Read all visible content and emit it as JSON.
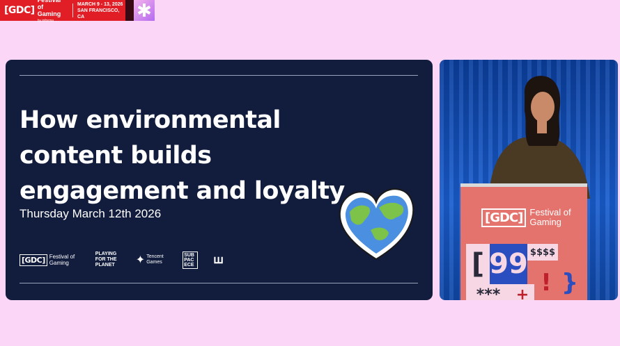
{
  "banner": {
    "logo": "[GDC]",
    "name": "Festival\nof Gaming",
    "by": "by informa",
    "dates": "MARCH 9 - 13, 2026",
    "location": "SAN FRANCISCO, CA",
    "spark_icon": "asterisk-icon"
  },
  "slide": {
    "title": "How environmental content builds engagement and loyalty",
    "date": "Thursday March 12th 2026",
    "illustration": "globe-heart-icon",
    "logos": {
      "gdc_box": "[GDC]",
      "gdc_text": "Festival of Gaming",
      "playing_for_planet": "PLAYING FOR THE PLANET",
      "tencent": "Tencent Games",
      "sub": "SUB PAC ECE"
    }
  },
  "camera": {
    "podium_logo_box": "[GDC]",
    "podium_logo_text": "Festival of Gaming",
    "tile_quote": "99",
    "tile_bracket": "[",
    "tile_bang": "!",
    "tile_stars": "***",
    "tile_plus": "+",
    "tile_dollars": "$$$$",
    "tile_brace": "}"
  },
  "colors": {
    "background": "#fcd6f6",
    "slide": "#121c3d",
    "banner_red": "#e11e26",
    "podium": "#e4736d"
  }
}
